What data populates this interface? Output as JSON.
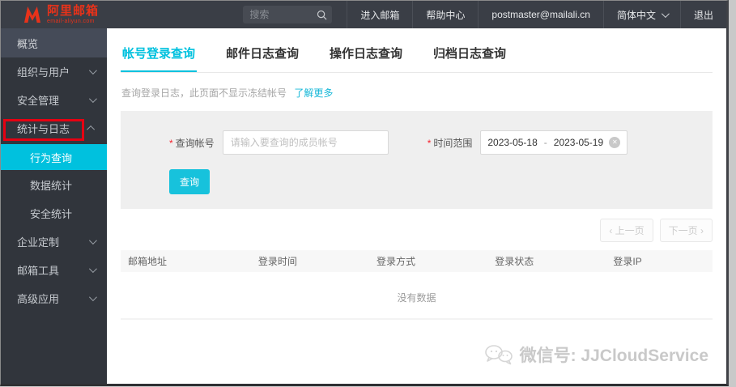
{
  "topbar": {
    "logo": {
      "title": "阿里邮箱",
      "subtitle": "email-aliyun.com"
    },
    "search": {
      "placeholder": "搜索"
    },
    "menu": [
      {
        "label": "进入邮箱"
      },
      {
        "label": "帮助中心"
      },
      {
        "label": "postmaster@mailali.cn"
      },
      {
        "label": "简体中文"
      },
      {
        "label": "退出"
      }
    ]
  },
  "sidebar": {
    "items": [
      {
        "label": "概览"
      },
      {
        "label": "组织与用户"
      },
      {
        "label": "安全管理"
      },
      {
        "label": "统计与日志"
      },
      {
        "label": "行为查询"
      },
      {
        "label": "数据统计"
      },
      {
        "label": "安全统计"
      },
      {
        "label": "企业定制"
      },
      {
        "label": "邮箱工具"
      },
      {
        "label": "高级应用"
      }
    ]
  },
  "tabs": [
    {
      "label": "帐号登录查询"
    },
    {
      "label": "邮件日志查询"
    },
    {
      "label": "操作日志查询"
    },
    {
      "label": "归档日志查询"
    }
  ],
  "main": {
    "info_text": "查询登录日志，此页面不显示冻结帐号",
    "info_link": "了解更多",
    "form": {
      "required_mark": "*",
      "account_label": "查询帐号",
      "account_placeholder": "请输入要查询的成员帐号",
      "range_label": "时间范围",
      "date_start": "2023-05-18",
      "date_separator": "-",
      "date_end": "2023-05-19",
      "submit_label": "查询"
    },
    "pagination": {
      "prev": "‹ 上一页",
      "next": "下一页 ›"
    },
    "table": {
      "headers": [
        "邮箱地址",
        "登录时间",
        "登录方式",
        "登录状态",
        "登录IP"
      ],
      "empty_text": "没有数据"
    },
    "watermark": "微信号: JJCloudService"
  },
  "colors": {
    "accent": "#00c1de",
    "annotation_red": "#e60012",
    "brand_red": "#e8321a"
  }
}
